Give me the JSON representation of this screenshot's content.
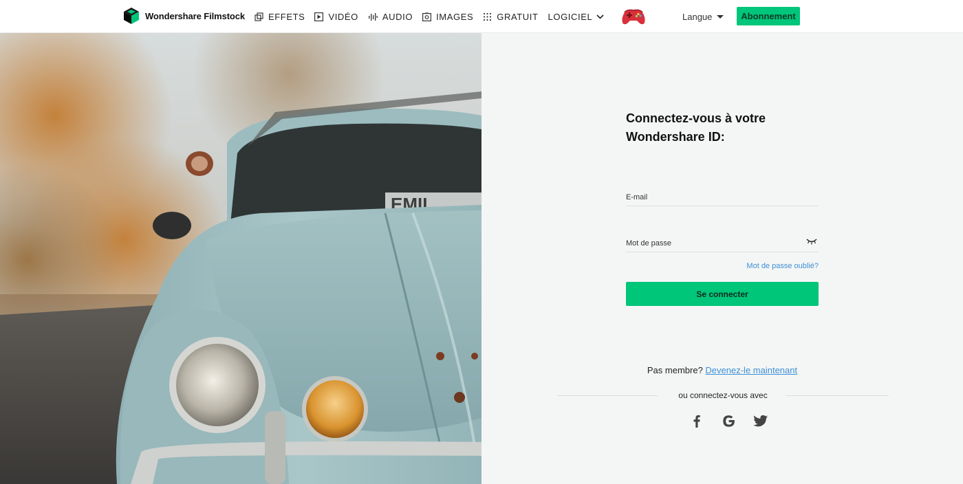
{
  "brand": {
    "name": "Wondershare Filmstock",
    "accent_color": "#00c67a",
    "link_color": "#3d8fd6"
  },
  "nav": {
    "items": [
      {
        "label": "EFFETS",
        "icon": "effects-icon"
      },
      {
        "label": "VIDÉO",
        "icon": "video-play-icon"
      },
      {
        "label": "AUDIO",
        "icon": "audio-wave-icon"
      },
      {
        "label": "IMAGES",
        "icon": "image-icon"
      },
      {
        "label": "GRATUIT",
        "icon": "grid-dots-icon"
      },
      {
        "label": "LOGICIEL",
        "icon": "chevron-down-icon"
      }
    ],
    "language_label": "Langue",
    "subscribe_label": "Abonnement"
  },
  "login": {
    "title_line1": "Connectez-vous à votre",
    "title_line2": "Wondershare ID:",
    "email_placeholder": "E-mail",
    "password_placeholder": "Mot de passe",
    "forgot_label": "Mot de passe oublié?",
    "submit_label": "Se connecter",
    "not_member_text": "Pas membre?",
    "signup_link": "Devenez-le maintenant",
    "alt_login_text": "ou connectez-vous avec",
    "social_providers": [
      "facebook-icon",
      "google-icon",
      "twitter-icon"
    ]
  }
}
